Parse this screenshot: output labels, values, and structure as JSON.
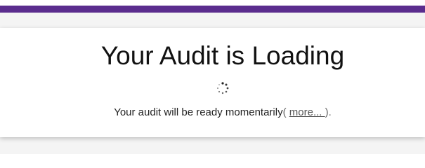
{
  "header": {
    "accent_color": "#5b2d8e"
  },
  "main": {
    "title": "Your Audit is Loading",
    "spinner_icon": "loading-spinner-icon",
    "message_text": "Your audit will be ready momentarily",
    "paren_open": "( ",
    "more_link_label": "more... ",
    "paren_close": ")."
  },
  "colors": {
    "page_background": "#f4f4f4",
    "card_background": "#ffffff",
    "title_text": "#111111",
    "link_text": "#555555"
  }
}
